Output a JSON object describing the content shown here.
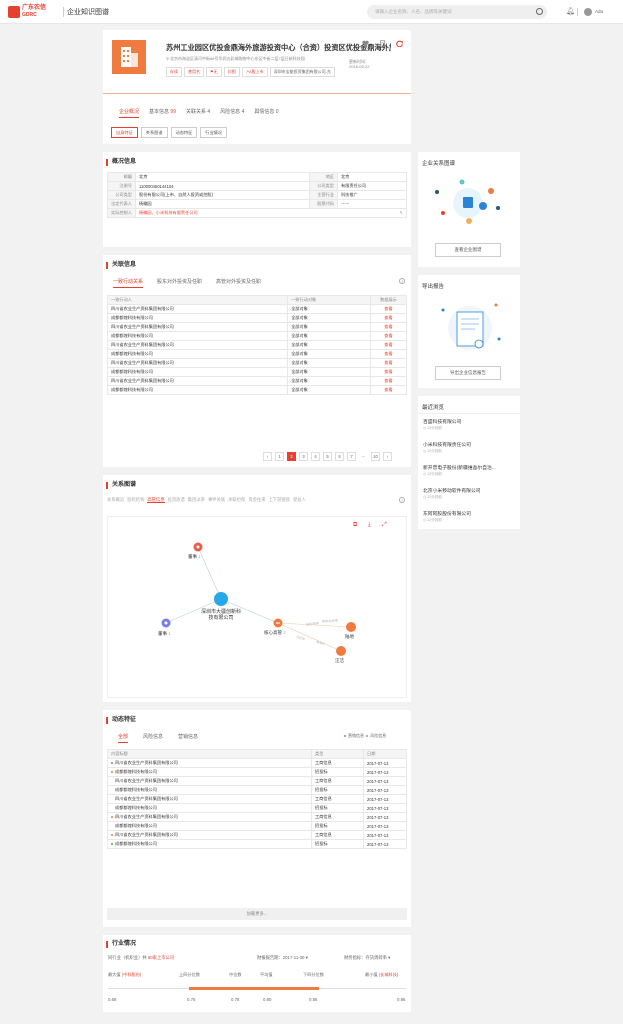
{
  "header": {
    "logo_cn": "广东农信",
    "logo_en": "GDRC",
    "app_title": "企业知识图谱",
    "search_placeholder": "请输入企业名称、人名、品牌等关键词",
    "user_name": "Ada"
  },
  "company": {
    "name": "苏州工业园区优投金鼎海外旅游投资中心（合资）投资区优投金鼎海外旅区",
    "address": "北京市海淀区清河中街68号华润五彩城购物中心东区中街二层7层日新科技园",
    "tags": [
      "存续",
      "曾用名",
      "无",
      "图",
      "A股上市",
      "深圳市宝能投资集团有限公司-东"
    ],
    "update_label": "更新时间：",
    "update_date": "2016-09-22",
    "tabs": [
      {
        "label": "企业概况",
        "count": ""
      },
      {
        "label": "基本信息",
        "count": "99"
      },
      {
        "label": "关联关系",
        "count": "4"
      },
      {
        "label": "风险信息",
        "count": "4"
      },
      {
        "label": "舆情信息",
        "count": "0"
      }
    ],
    "subtabs": [
      "自身特征",
      "关系图谱",
      "动态特征",
      "行业情况"
    ]
  },
  "overview": {
    "title": "概况信息",
    "rows": [
      [
        "邮编",
        "北京",
        "地区",
        "北京"
      ],
      [
        "注册号",
        "110000450144104",
        "公司类型",
        "有限责任公司"
      ],
      [
        "公司类型",
        "股份有限公司(上市、自然人投资或控股)",
        "主营行业",
        "科技推广"
      ],
      [
        "法定代表人",
        "杨橄园",
        "股票代码",
        "－－"
      ]
    ],
    "controller_label": "实际控制人",
    "controller_value": "杨橄园、小米科技有限责任公司"
  },
  "related": {
    "title": "关联信息",
    "tabs": [
      "一致行动关系",
      "股东对外投资及任职",
      "高管对外投资及任职"
    ],
    "headers": [
      "一致行动人",
      "一致行动对象",
      "数据展示"
    ],
    "rows": [
      [
        "四川省农业生产资料集团有限公司",
        "全部对象",
        "查看"
      ],
      [
        "成都都煌科技有限公司",
        "全部对象",
        "查看"
      ],
      [
        "四川省农业生产资料集团有限公司",
        "全部对象",
        "查看"
      ],
      [
        "成都都煌科技有限公司",
        "全部对象",
        "查看"
      ],
      [
        "四川省农业生产资料集团有限公司",
        "全部对象",
        "查看"
      ],
      [
        "成都都煌科技有限公司",
        "全部对象",
        "查看"
      ],
      [
        "四川省农业生产资料集团有限公司",
        "全部对象",
        "查看"
      ],
      [
        "成都都煌科技有限公司",
        "全部对象",
        "查看"
      ],
      [
        "四川省农业生产资料集团有限公司",
        "全部对象",
        "查看"
      ],
      [
        "成都都煌科技有限公司",
        "全部对象",
        "查看"
      ]
    ],
    "pages": [
      "1",
      "2",
      "3",
      "4",
      "5",
      "6",
      "7",
      "...",
      "10"
    ]
  },
  "graph": {
    "title": "关系图谱",
    "tabs": [
      "关系概览",
      "股权结构",
      "高管信息",
      "投资族谱",
      "集团派系",
      "事件关联",
      "关联担保",
      "资金往来",
      "上下游链接",
      "受益人"
    ],
    "center": "深圳市大疆创新科技有限公司",
    "nodes": {
      "director1": "董事",
      "director1_count": "1",
      "director2": "董事",
      "director2_count": "1",
      "exec": "核心高管",
      "exec_count": "2",
      "p1": "陆地",
      "p2": "汪洁"
    },
    "edge_labels": [
      "董事/董事",
      "董事/总经理",
      "总经理",
      "董事长"
    ]
  },
  "dynamics": {
    "title": "动态特征",
    "tabs": [
      "全部",
      "风险信息",
      "营销信息"
    ],
    "legend": [
      "营销信息",
      "风险信息"
    ],
    "headers": [
      "内容标题",
      "类型",
      "日期"
    ],
    "rows": [
      [
        "四川省农业生产资料集团有限公司",
        "工商信息",
        "2017-07-13",
        "green"
      ],
      [
        "成都都煌科技有限公司",
        "招投标",
        "2017-07-13",
        "orange"
      ],
      [
        "四川省农业生产资料集团有限公司",
        "工商信息",
        "2017-07-13",
        "none"
      ],
      [
        "成都都煌科技有限公司",
        "招投标",
        "2017-07-13",
        "none"
      ],
      [
        "四川省农业生产资料集团有限公司",
        "工商信息",
        "2017-07-13",
        "none"
      ],
      [
        "成都都煌科技有限公司",
        "招投标",
        "2017-07-13",
        "none"
      ],
      [
        "四川省农业生产资料集团有限公司",
        "工商信息",
        "2017-07-13",
        "orange"
      ],
      [
        "成都都煌科技有限公司",
        "招投标",
        "2017-07-13",
        "none"
      ],
      [
        "四川省农业生产资料集团有限公司",
        "工商信息",
        "2017-07-13",
        "orange"
      ],
      [
        "成都都煌科技有限公司",
        "招投标",
        "2017-07-13",
        "green"
      ]
    ],
    "load_more": "加载更多..."
  },
  "industry": {
    "title": "行业情况",
    "peers_prefix": "同行业（机织业）共",
    "peers_count": "60家上市公司",
    "report_date_label": "财报报告期：",
    "report_date": "2017-11-30",
    "metric_label": "财务指标：",
    "metric": "存货周转率",
    "labels": [
      "最大值",
      "上四分位数",
      "中位数",
      "平均值",
      "下四分位数",
      "最小值"
    ],
    "max_company": "(中科股份)",
    "min_company": "(长城科技)",
    "values": [
      "0.68",
      "0.76",
      "0.78",
      "0.80",
      "0.86",
      "0.96"
    ]
  },
  "sidebar": {
    "relation_title": "企业关系图谱",
    "relation_button": "查看企业图谱",
    "report_title": "导出报告",
    "report_button": "导出企业信息报告",
    "recent_title": "最近浏览",
    "recent": [
      {
        "name": "百盛科技有限公司",
        "sub": "12分钟前"
      },
      {
        "name": "小米科技有限责任公司",
        "sub": "12分钟前"
      },
      {
        "name": "新开普电子股份(新疆维吾尔自治...",
        "sub": "12分钟前"
      },
      {
        "name": "北京小米移动软件有限公司",
        "sub": "12分钟前"
      },
      {
        "name": "东阿阿胶股份有限公司",
        "sub": "12分钟前"
      }
    ]
  },
  "colors": {
    "accent": "#e4412f",
    "orange": "#f07b3f",
    "blue": "#28a8e8",
    "purple": "#7b7ee8",
    "green": "#4caf50"
  }
}
